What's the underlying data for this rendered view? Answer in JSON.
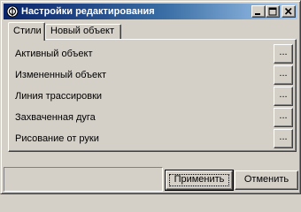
{
  "window": {
    "title": "Настройки редактирования",
    "title_bar_buttons": {
      "minimize": "minimize-icon",
      "maximize": "maximize-icon",
      "close": "close-icon"
    }
  },
  "tabs": [
    {
      "label": "Стили",
      "active": true
    },
    {
      "label": "Новый объект",
      "active": false
    }
  ],
  "styles": {
    "rows": [
      {
        "label": "Активный объект",
        "button": "..."
      },
      {
        "label": "Измененный объект",
        "button": "..."
      },
      {
        "label": "Линия трассировки",
        "button": "..."
      },
      {
        "label": "Захваченная дуга",
        "button": "..."
      },
      {
        "label": "Рисование от руки",
        "button": "..."
      }
    ]
  },
  "footer": {
    "apply_label": "Применить",
    "cancel_label": "Отменить"
  },
  "colors": {
    "titlebar_start": "#0a246a",
    "titlebar_end": "#a6caf0",
    "face": "#d4d0c8"
  }
}
